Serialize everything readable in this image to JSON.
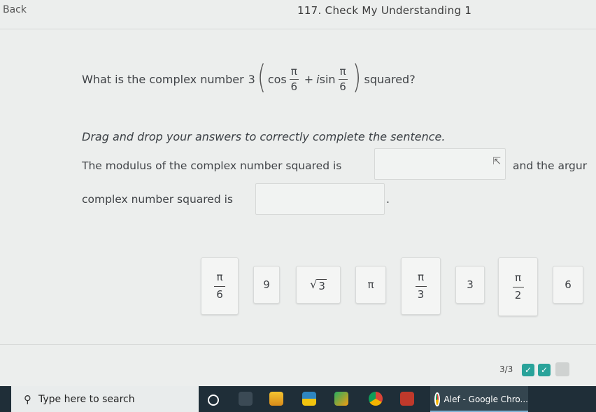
{
  "header": {
    "back_label": "Back",
    "title": "117. Check My Understanding 1"
  },
  "question": {
    "prefix": "What is the complex number",
    "coef": "3",
    "cos": "cos",
    "frac_num": "π",
    "frac_den": "6",
    "plus": "+",
    "i": "i",
    "sin": "sin",
    "suffix": "squared?"
  },
  "instruction": "Drag and drop your answers to correctly complete the sentence.",
  "sentence": {
    "part1": "The modulus of the complex number squared is",
    "part2": "and the argur",
    "part3": "complex number squared is",
    "part4": "."
  },
  "tiles": [
    {
      "type": "frac",
      "num": "π",
      "den": "6"
    },
    {
      "type": "text",
      "text": "9"
    },
    {
      "type": "sqrt",
      "text": "3"
    },
    {
      "type": "text",
      "text": "π"
    },
    {
      "type": "frac",
      "num": "π",
      "den": "3"
    },
    {
      "type": "text",
      "text": "3"
    },
    {
      "type": "frac",
      "num": "π",
      "den": "2"
    },
    {
      "type": "text",
      "text": "6"
    }
  ],
  "progress": {
    "label": "3/3"
  },
  "taskbar": {
    "search_placeholder": "Type here to search",
    "active_app": "Alef - Google Chro..."
  },
  "colors": {
    "accent": "#29a39a",
    "taskbar": "#1f2e38"
  }
}
